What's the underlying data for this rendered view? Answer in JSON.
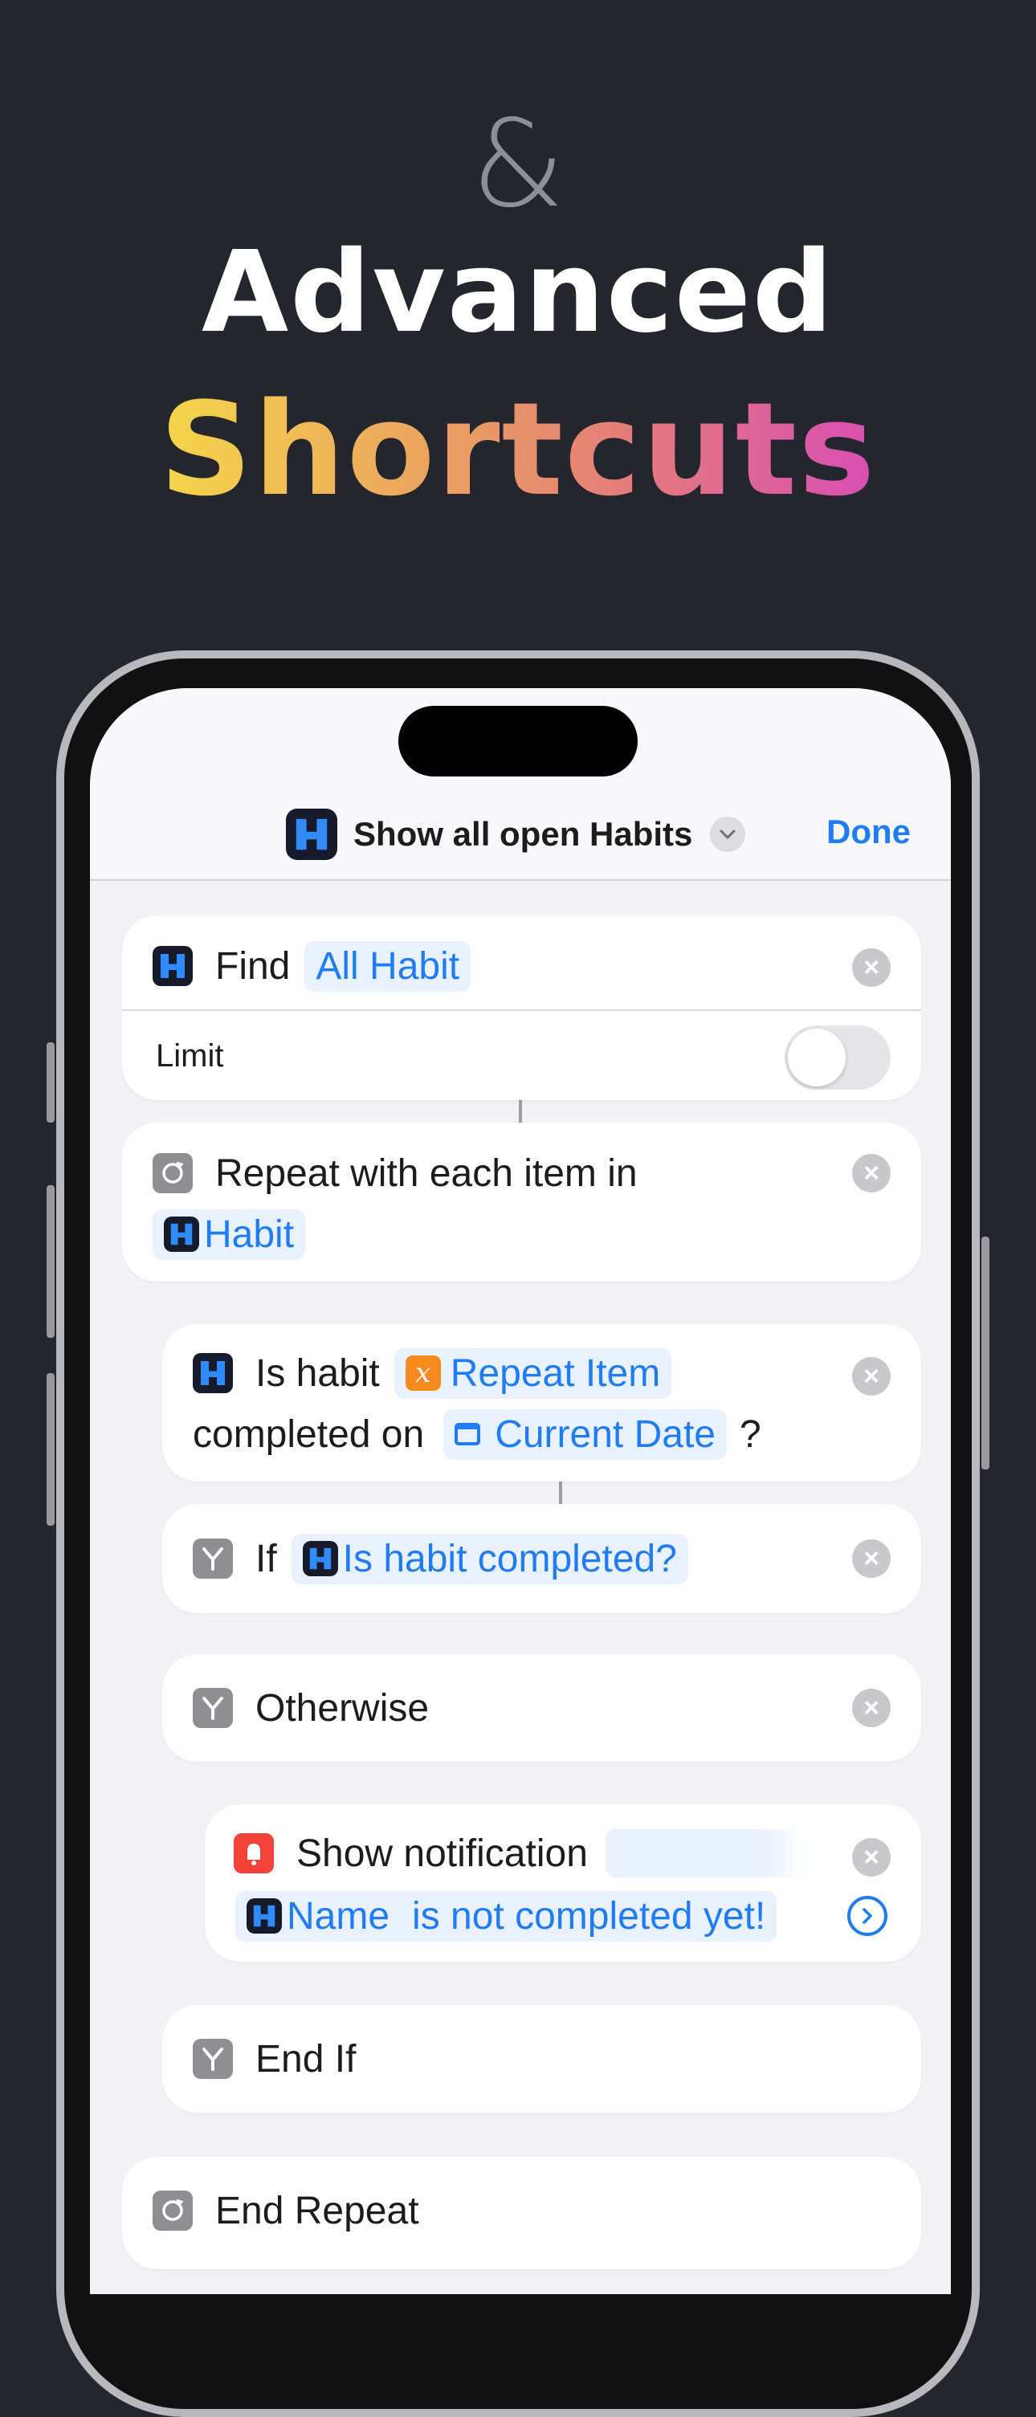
{
  "hero": {
    "ampersand": "&",
    "line1": "Advanced",
    "line2": "Shortcuts"
  },
  "navbar": {
    "title": "Show all open Habits",
    "done_label": "Done"
  },
  "actions": {
    "find": {
      "label": "Find",
      "token": "All Habit",
      "limit_label": "Limit",
      "limit_on": false
    },
    "repeat": {
      "label": "Repeat with each item in",
      "token": "Habit"
    },
    "is_habit": {
      "label1": "Is habit",
      "token1": "Repeat Item",
      "label2": "completed on",
      "token2": "Current Date",
      "suffix": "?"
    },
    "if": {
      "label": "If",
      "token": "Is habit completed?"
    },
    "otherwise": {
      "label": "Otherwise"
    },
    "notification": {
      "label": "Show notification",
      "token": "Name",
      "text": "is not completed yet!"
    },
    "end_if": {
      "label": "End If"
    },
    "end_repeat": {
      "label": "End Repeat"
    }
  },
  "colors": {
    "accent": "#1f7cf5",
    "background": "#24252d",
    "screen": "#f2f2f7",
    "gradient": [
      "#f4d64b",
      "#d84fb3"
    ]
  }
}
